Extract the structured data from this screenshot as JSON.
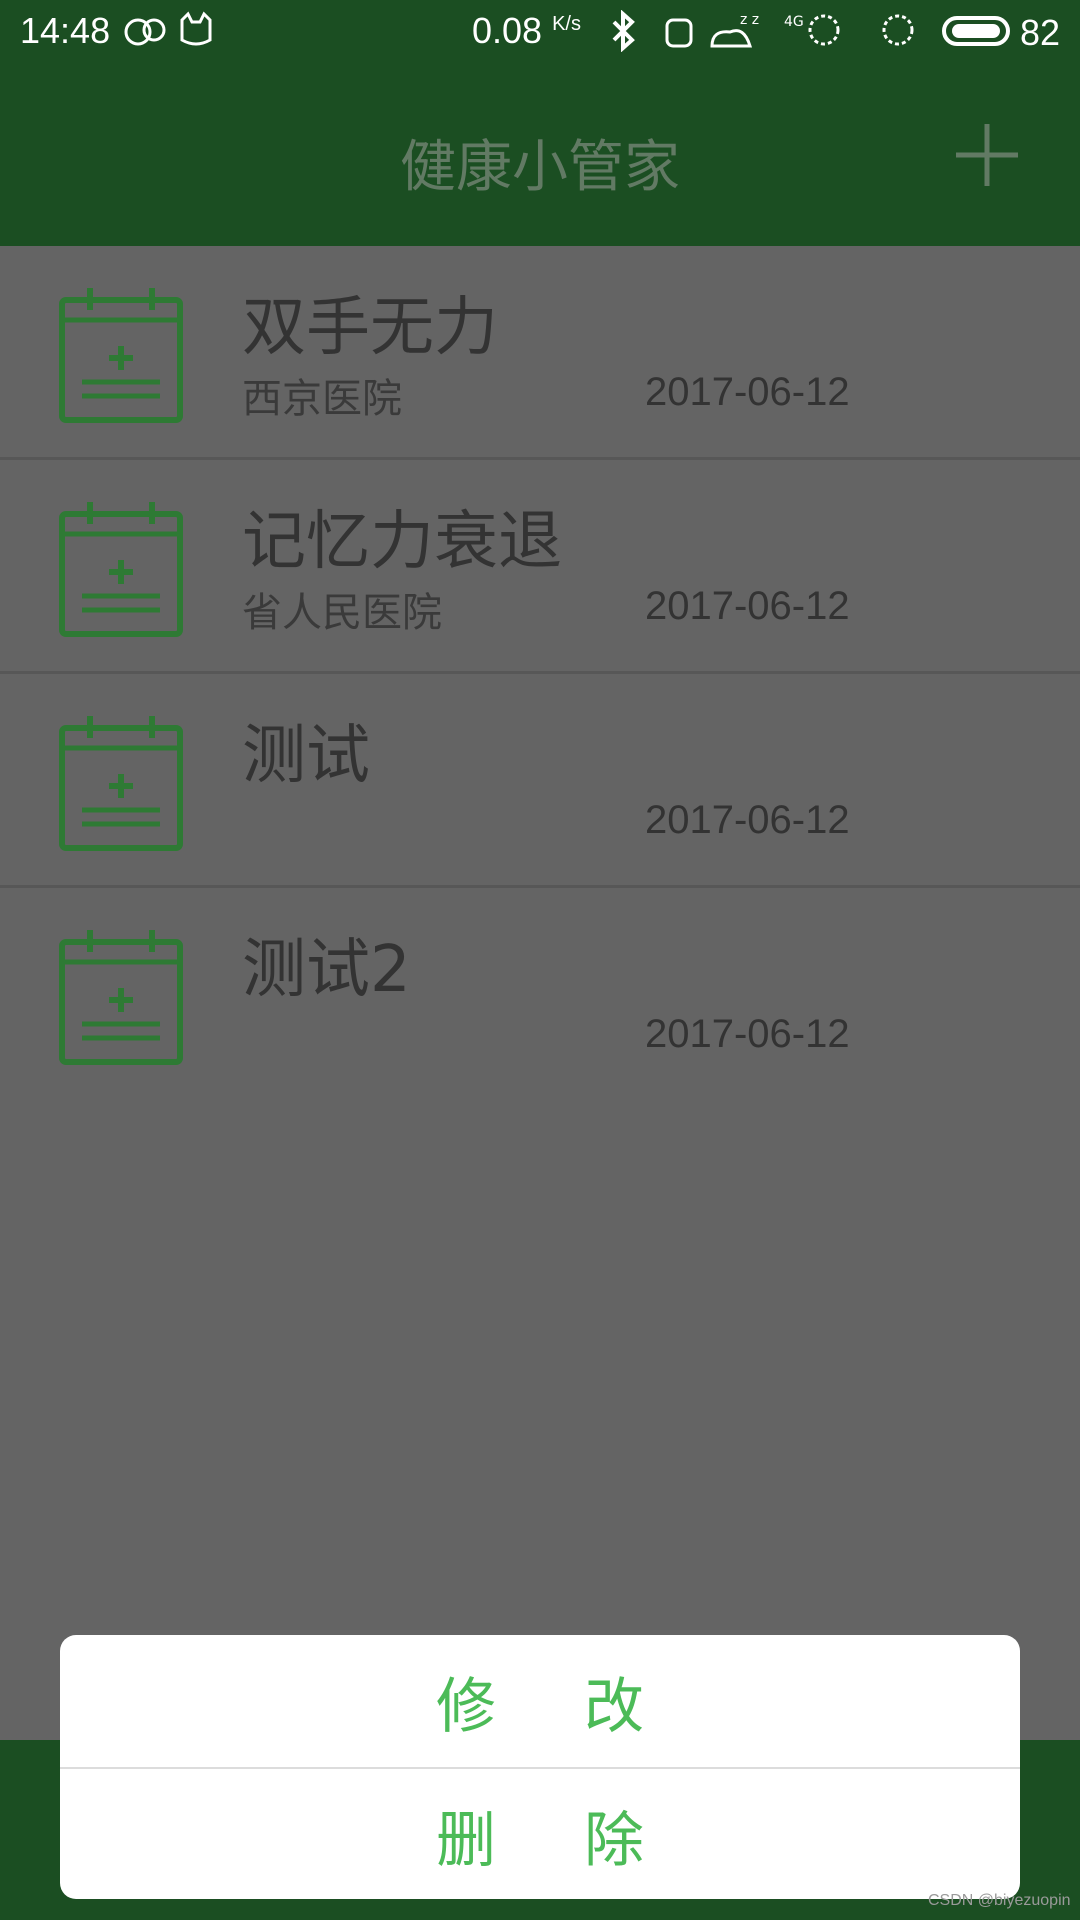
{
  "status_bar": {
    "time": "14:48",
    "net_speed": "0.08",
    "net_unit": "K/s",
    "network_type": "4G",
    "battery": "82"
  },
  "header": {
    "title": "健康小管家",
    "add_icon": "plus-icon"
  },
  "records": [
    {
      "title": "双手无力",
      "hospital": "西京医院",
      "date": "2017-06-12"
    },
    {
      "title": "记忆力衰退",
      "hospital": "省人民医院",
      "date": "2017-06-12"
    },
    {
      "title": "测试",
      "hospital": "",
      "date": "2017-06-12"
    },
    {
      "title": "测试2",
      "hospital": "",
      "date": "2017-06-12"
    }
  ],
  "dialog": {
    "edit_char1": "修",
    "edit_char2": "改",
    "delete_char1": "删",
    "delete_char2": "除"
  },
  "watermark": "CSDN @biyezuopin",
  "colors": {
    "primary": "#1b4e22",
    "accent": "#4cbb58",
    "icon": "#2e7a34",
    "overlay_bg": "#646464"
  }
}
